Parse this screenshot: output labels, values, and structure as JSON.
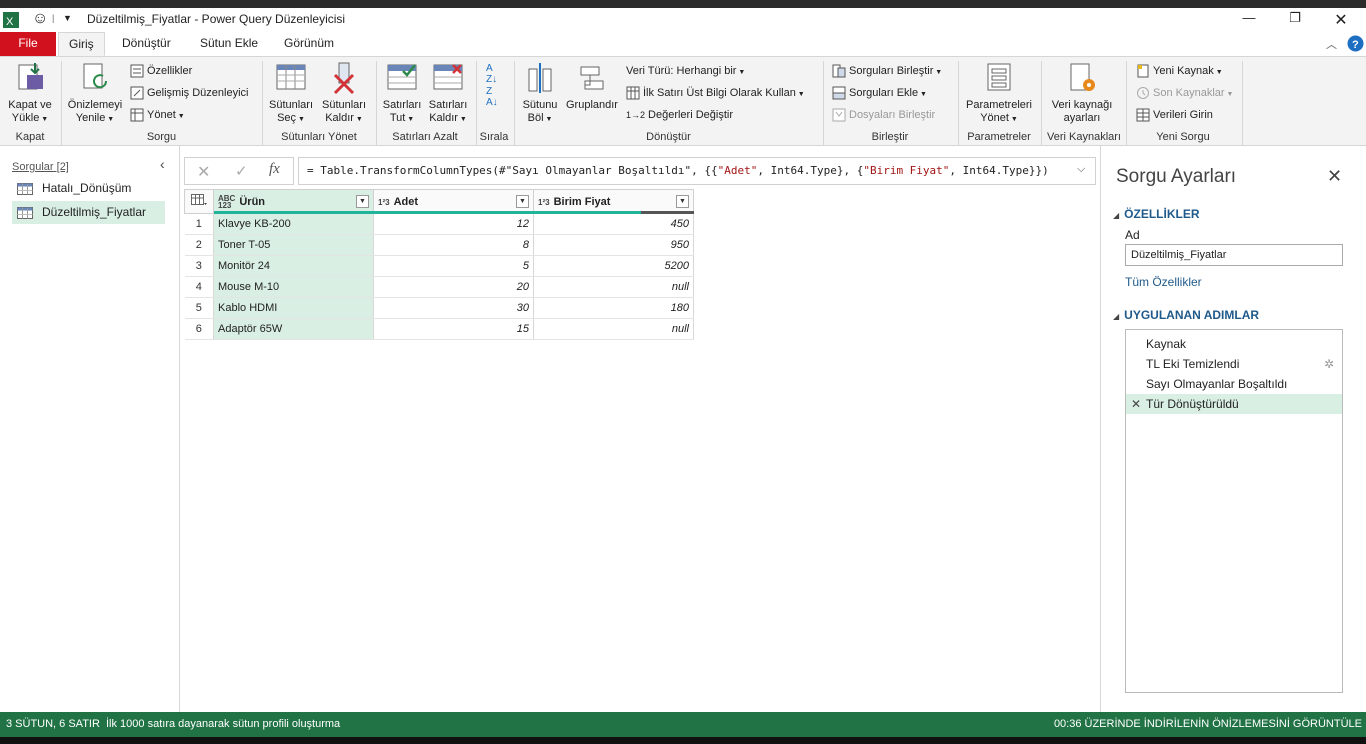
{
  "window": {
    "title": "Düzeltilmiş_Fiyatlar - Power Query Düzenleyicisi",
    "colors": {
      "accent": "#217346",
      "file_tab": "#d1111d",
      "selection": "#d9efe3",
      "link": "#1f5a8a"
    }
  },
  "tabs": [
    "File",
    "Giriş",
    "Dönüştür",
    "Sütun Ekle",
    "Görünüm"
  ],
  "ribbon": {
    "kapat": {
      "button": "Kapat ve\nYükle",
      "label": "Kapat"
    },
    "sorgu": {
      "onizlemeyi": "Önizlemeyi\nYenile",
      "ozellikler": "Özellikler",
      "gelismis": "Gelişmiş Düzenleyici",
      "yonet": "Yönet",
      "label": "Sorgu"
    },
    "sutunlari_yonet": {
      "sec": "Sütunları\nSeç",
      "kaldir": "Sütunları\nKaldır",
      "label": "Sütunları Yönet"
    },
    "satirlari_azalt": {
      "tut": "Satırları\nTut",
      "kaldir": "Satırları\nKaldır",
      "label": "Satırları Azalt"
    },
    "sirala": {
      "label": "Sırala"
    },
    "donustur": {
      "bol": "Sütunu\nBöl",
      "grup": "Gruplandır",
      "veri_turu": "Veri Türü: Herhangi bir",
      "ilk_satir": "İlk Satırı Üst Bilgi Olarak Kullan",
      "degerleri": "Değerleri Değiştir",
      "label": "Dönüştür"
    },
    "birlestir": {
      "sorgulari": "Sorguları Birleştir",
      "ekle": "Sorguları Ekle",
      "dosyalari": "Dosyaları Birleştir",
      "label": "Birleştir"
    },
    "parametreler": {
      "yonet": "Parametreleri\nYönet",
      "label": "Parametreler"
    },
    "veri_kaynaklari": {
      "ayarlar": "Veri kaynağı\nayarları",
      "label": "Veri Kaynakları"
    },
    "yeni_sorgu": {
      "yeni": "Yeni Kaynak",
      "son": "Son Kaynaklar",
      "veri": "Verileri Girin",
      "label": "Yeni Sorgu"
    }
  },
  "queries": {
    "header": "Sorgular [2]",
    "items": [
      "Hatalı_Dönüşüm",
      "Düzeltilmiş_Fiyatlar"
    ]
  },
  "formula": {
    "p1": "= Table.TransformColumnTypes(#\"Sayı Olmayanlar Boşaltıldı\", {{",
    "s1": "\"Adet\"",
    "p2": ", Int64.Type}, {",
    "s2": "\"Birim Fiyat\"",
    "p3": ", Int64.Type}})"
  },
  "grid": {
    "columns": [
      {
        "type": "ABC\n123",
        "name": "Ürün"
      },
      {
        "type": "1²3",
        "name": "Adet"
      },
      {
        "type": "1²3",
        "name": "Birim Fiyat"
      }
    ],
    "rows": [
      {
        "n": "1",
        "urun": "Klavye KB-200",
        "adet": "12",
        "fiyat": "450"
      },
      {
        "n": "2",
        "urun": "Toner T-05",
        "adet": "8",
        "fiyat": "950"
      },
      {
        "n": "3",
        "urun": "Monitör 24",
        "adet": "5",
        "fiyat": "5200"
      },
      {
        "n": "4",
        "urun": "Mouse M-10",
        "adet": "20",
        "fiyat": "null"
      },
      {
        "n": "5",
        "urun": "Kablo HDMI",
        "adet": "30",
        "fiyat": "180"
      },
      {
        "n": "6",
        "urun": "Adaptör 65W",
        "adet": "15",
        "fiyat": "null"
      }
    ]
  },
  "settings": {
    "title": "Sorgu Ayarları",
    "properties_header": "ÖZELLİKLER",
    "name_label": "Ad",
    "name_value": "Düzeltilmiş_Fiyatlar",
    "all_properties": "Tüm Özellikler",
    "steps_header": "UYGULANAN ADIMLAR",
    "steps": [
      "Kaynak",
      "TL Eki Temizlendi",
      "Sayı Olmayanlar Boşaltıldı",
      "Tür Dönüştürüldü"
    ]
  },
  "status": {
    "left1": "3 SÜTUN, 6 SATIR",
    "left2": "İlk 1000 satıra dayanarak sütun profili oluşturma",
    "right": "00:36 ÜZERİNDE İNDİRİLENİN ÖNİZLEMESİNİ GÖRÜNTÜLE"
  }
}
